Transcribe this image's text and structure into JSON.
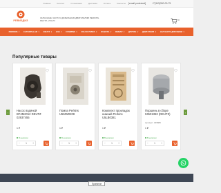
{
  "topbar": {
    "links": [
      "Главная",
      "Каталог",
      "О компании",
      "Доставка",
      "Оплата",
      "Контакты"
    ],
    "email": "[email protected]",
    "phone": "+7(343)300-00-75"
  },
  "header": {
    "logo_text": "РЕВИЗДИЗ",
    "tagline": "ЗАПАСНЫЕ ЧАСТИ К ДИЗЕЛЬНЫМ ДВИГАТЕЛЯМ PERKINS, DEUTZ, VOLVO",
    "cart_count": "0"
  },
  "nav": [
    {
      "label": "PERKINS",
      "caret": "▼"
    },
    {
      "label": "CATERPILLAR",
      "caret": "▼"
    },
    {
      "label": "DEUTZ",
      "caret": "▼"
    },
    {
      "label": "JCB",
      "caret": "▼"
    },
    {
      "label": "CUMMINS",
      "caret": "▼"
    },
    {
      "label": "VOLVO PENTA",
      "caret": "▼"
    },
    {
      "label": "KUBOTA",
      "caret": "▼"
    },
    {
      "label": "ЯНМАР",
      "caret": "▼"
    },
    {
      "label": "ДРУГИЕ",
      "caret": "▼"
    },
    {
      "label": "ДВИГАТЕЛИ",
      "caret": "▼"
    },
    {
      "label": "ЗАПЧАСТИ ДЛЯ МИНИ",
      "caret": "▼"
    }
  ],
  "section_title": "Популярные товары",
  "products": [
    {
      "name": "Насос водяной BF4M2012 DEUTZ 02937455",
      "article": "",
      "price": "1 ₽",
      "stock": "В наличии",
      "qty": "1"
    },
    {
      "name": "Помпа Perkins U5MW0208",
      "article": "",
      "price": "1 ₽",
      "stock": "В наличии",
      "qty": "1"
    },
    {
      "name": "Комплект прокладок нижний Perkins U5LB0381",
      "article": "",
      "price": "1 ₽",
      "stock": "В наличии",
      "qty": "1"
    },
    {
      "name": "Поршень в сборе 04501353 (DEUTZ)",
      "article": "Артикул: 469880",
      "price": "1 ₽",
      "stock": "В наличии",
      "qty": "1"
    }
  ],
  "qty_minus": "−",
  "qty_plus": "+",
  "arrows": {
    "left": "‹",
    "right": "›"
  },
  "cookie_button": "Принятие",
  "colors": {
    "accent": "#e8612c",
    "nav": "#e8612c",
    "arrow": "#6c9b3c",
    "footer": "#3f4755",
    "whatsapp": "#25d366"
  },
  "icons": [
    "logo-icon",
    "cart-icon",
    "heart-icon",
    "cart-add-icon",
    "whatsapp-icon",
    "chevron-left-icon",
    "chevron-right-icon"
  ]
}
